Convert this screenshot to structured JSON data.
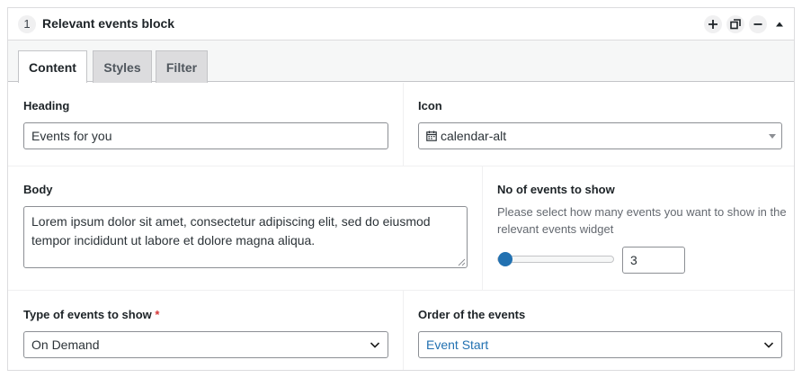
{
  "block": {
    "number": "1",
    "title": "Relevant events block",
    "header_icons": [
      "plus-icon",
      "duplicate-icon",
      "minus-icon",
      "collapse-icon"
    ]
  },
  "tabs": [
    {
      "label": "Content",
      "active": true
    },
    {
      "label": "Styles",
      "active": false
    },
    {
      "label": "Filter",
      "active": false
    }
  ],
  "fields": {
    "heading": {
      "label": "Heading",
      "value": "Events for you"
    },
    "icon": {
      "label": "Icon",
      "value": "calendar-alt"
    },
    "body": {
      "label": "Body",
      "value": "Lorem ipsum dolor sit amet, consectetur adipiscing elit, sed do eiusmod tempor incididunt ut labore et dolore magna aliqua."
    },
    "count": {
      "label": "No of events to show",
      "description": "Please select how many events you want to show in the relevant events widget",
      "value": "3",
      "slider_fraction": 0.0
    },
    "type": {
      "label": "Type of events to show",
      "required_mark": "*",
      "value": "On Demand"
    },
    "order": {
      "label": "Order of the events",
      "value": "Event Start"
    }
  },
  "colors": {
    "accent": "#2271b1",
    "required": "#d63638",
    "border": "#8c8f94"
  }
}
